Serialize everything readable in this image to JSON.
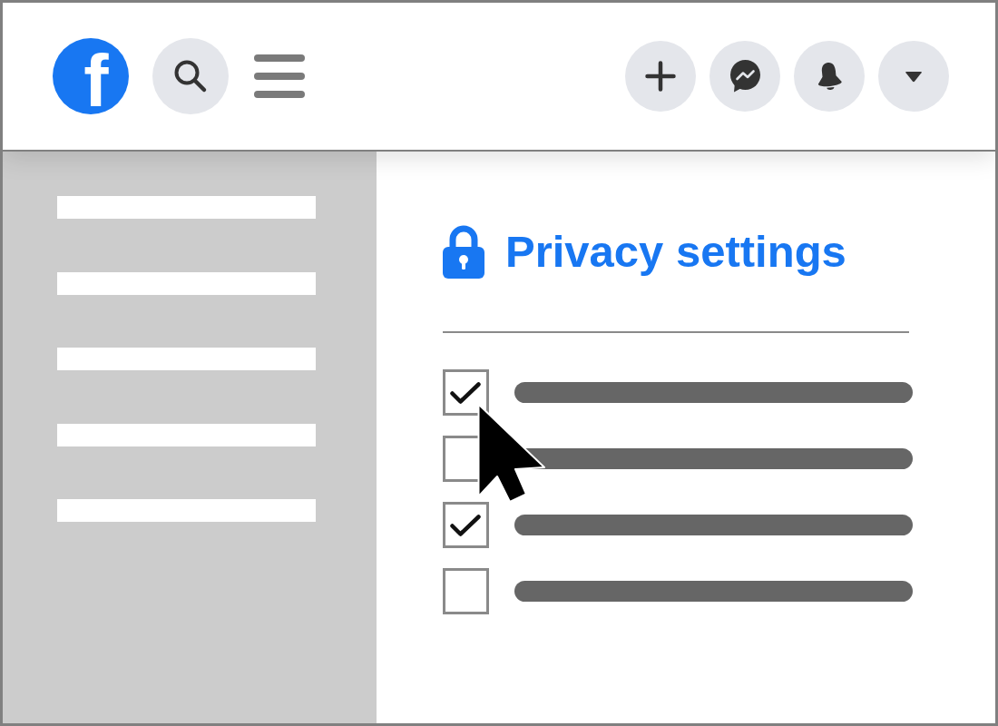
{
  "header": {
    "logo": "f"
  },
  "privacy_panel": {
    "title": "Privacy settings",
    "options": [
      {
        "checked": true
      },
      {
        "checked": false
      },
      {
        "checked": true
      },
      {
        "checked": false
      }
    ]
  }
}
